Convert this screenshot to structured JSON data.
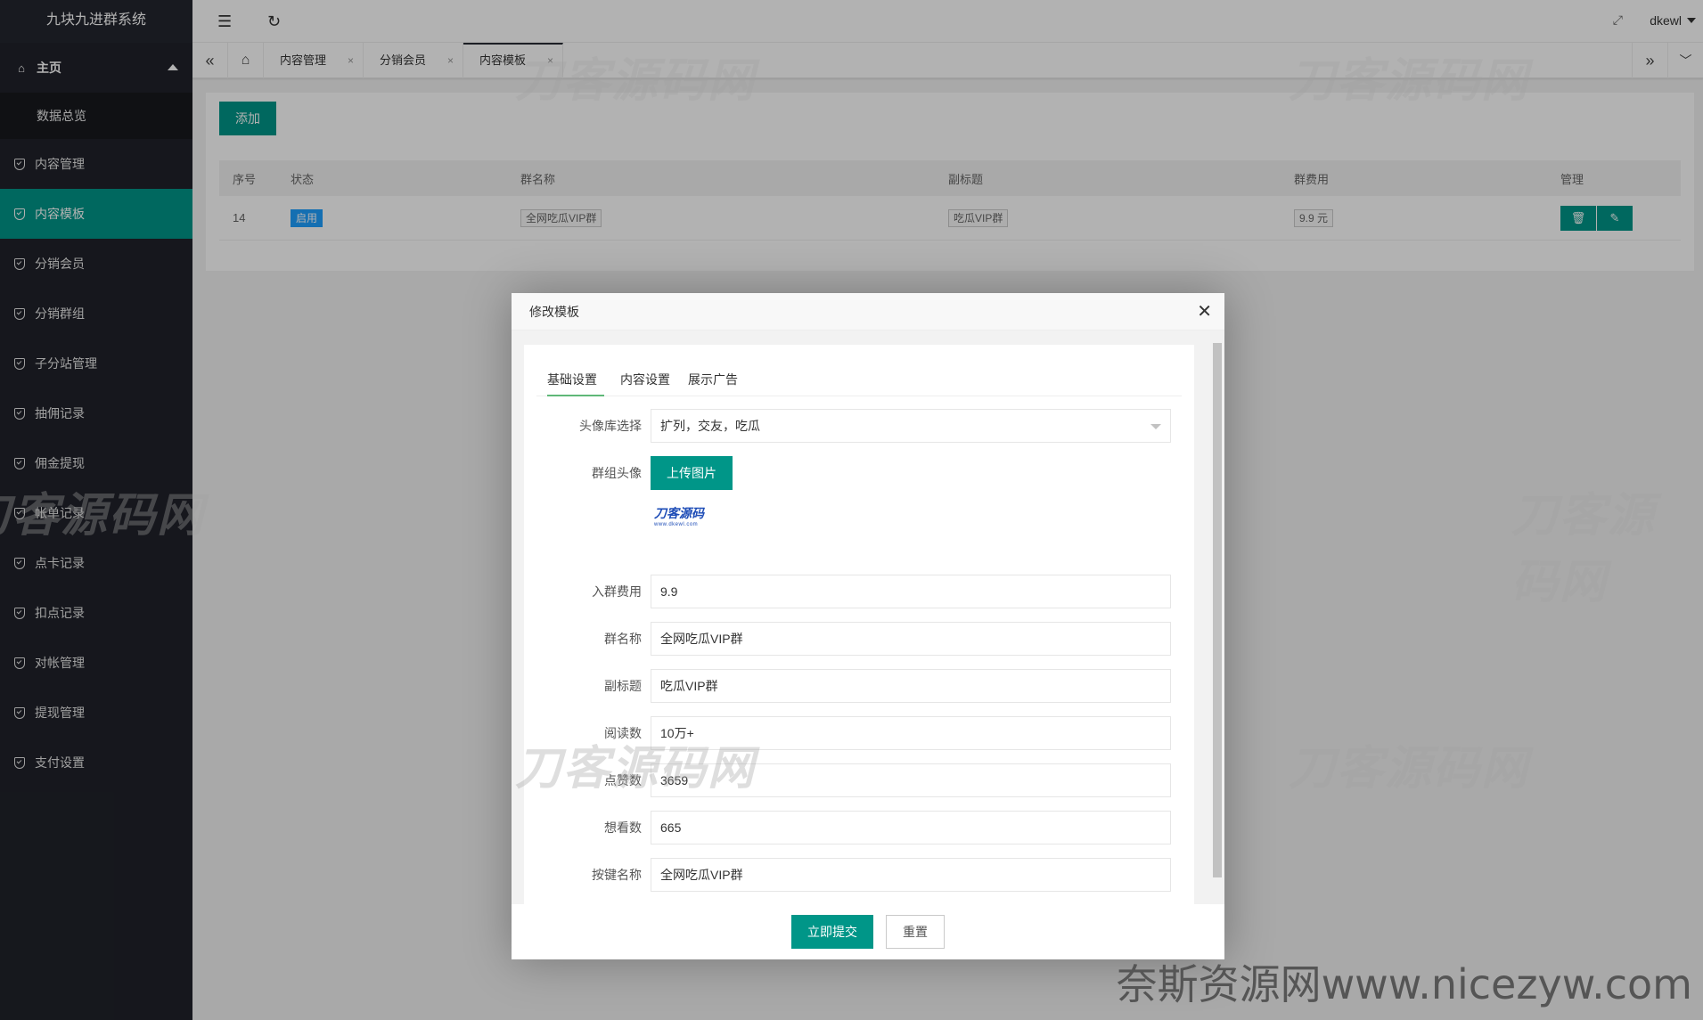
{
  "sidebar": {
    "logo": "九块九进群系统",
    "home_label": "主页",
    "sub_item": "数据总览",
    "items": [
      {
        "label": "内容管理"
      },
      {
        "label": "内容模板"
      },
      {
        "label": "分销会员"
      },
      {
        "label": "分销群组"
      },
      {
        "label": "子分站管理"
      },
      {
        "label": "抽佣记录"
      },
      {
        "label": "佣金提现"
      },
      {
        "label": "帐单记录"
      },
      {
        "label": "点卡记录"
      },
      {
        "label": "扣点记录"
      },
      {
        "label": "对帐管理"
      },
      {
        "label": "提现管理"
      },
      {
        "label": "支付设置"
      }
    ],
    "active_item": "内容模板"
  },
  "header": {
    "username": "dkewl"
  },
  "tabs": [
    {
      "label": "内容管理"
    },
    {
      "label": "分销会员"
    },
    {
      "label": "内容模板"
    }
  ],
  "main": {
    "add_button": "添加",
    "table": {
      "columns": [
        "序号",
        "状态",
        "群名称",
        "副标题",
        "群费用",
        "管理"
      ],
      "rows": [
        {
          "id": "14",
          "status": "启用",
          "name": "全网吃瓜VIP群",
          "subtitle": "吃瓜VIP群",
          "fee": "9.9 元"
        }
      ]
    }
  },
  "dialog": {
    "title": "修改模板",
    "tabs": [
      "基础设置",
      "内容设置",
      "展示广告"
    ],
    "fields": {
      "avatar_lib": {
        "label": "头像库选择",
        "value": "扩列，交友，吃瓜"
      },
      "group_avatar": {
        "label": "群组头像",
        "button": "上传图片"
      },
      "fee": {
        "label": "入群费用",
        "value": "9.9"
      },
      "name": {
        "label": "群名称",
        "value": "全网吃瓜VIP群"
      },
      "subtitle": {
        "label": "副标题",
        "value": "吃瓜VIP群"
      },
      "reads": {
        "label": "阅读数",
        "value": "10万+"
      },
      "likes": {
        "label": "点赞数",
        "value": "3659"
      },
      "wants": {
        "label": "想看数",
        "value": "665"
      },
      "btn_name": {
        "label": "按键名称",
        "value": "全网吃瓜VIP群"
      }
    },
    "submit": "立即提交",
    "reset": "重置"
  },
  "watermark": {
    "text": "刀客源码网",
    "site": "奈斯资源网www.nicezyw.com",
    "preview_logo": "刀客源码",
    "preview_url": "www.dkewl.com"
  },
  "colors": {
    "accent": "#009688",
    "sidebar": "#20222a",
    "badge": "#1E9FFF"
  }
}
